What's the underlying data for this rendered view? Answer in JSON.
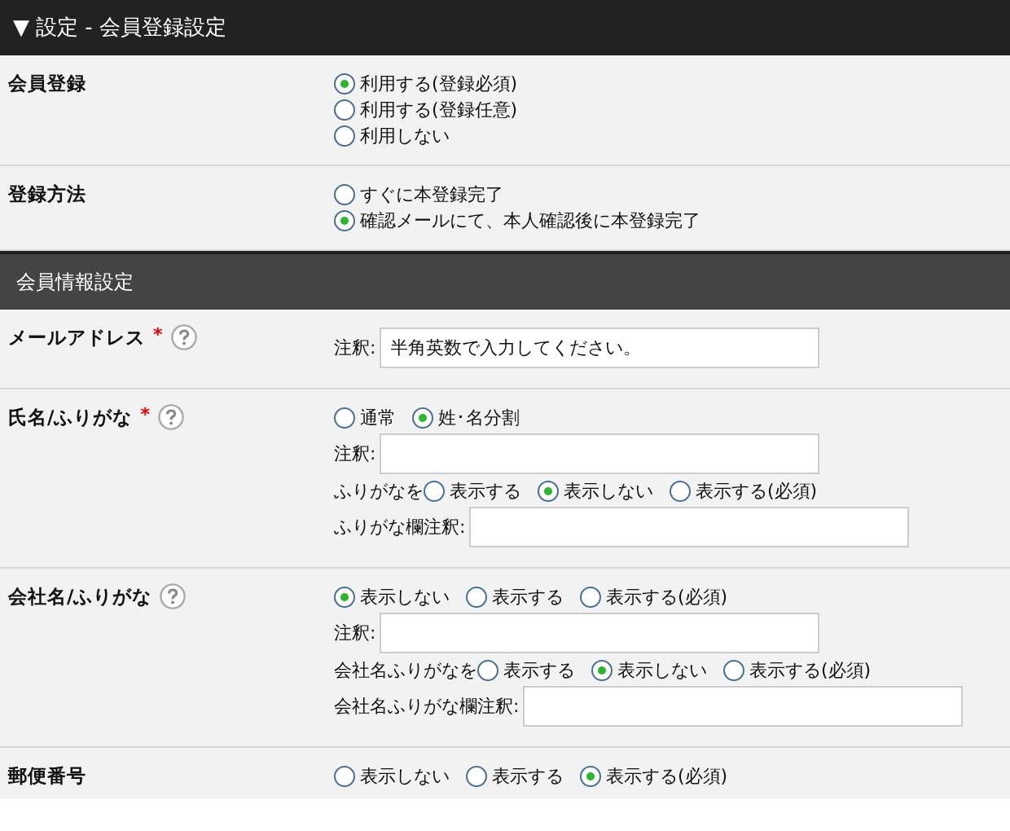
{
  "header": {
    "toggle": "▼",
    "title": "設定 - 会員登録設定"
  },
  "sections": [
    {
      "rows": [
        {
          "label": "会員登録",
          "lines": [
            {
              "kind": "radios",
              "options": [
                {
                  "label": "利用する(登録必須)",
                  "selected": true
                }
              ]
            },
            {
              "kind": "radios",
              "options": [
                {
                  "label": "利用する(登録任意)",
                  "selected": false
                }
              ]
            },
            {
              "kind": "radios",
              "options": [
                {
                  "label": "利用しない",
                  "selected": false
                }
              ]
            }
          ]
        },
        {
          "label": "登録方法",
          "lines": [
            {
              "kind": "radios",
              "options": [
                {
                  "label": "すぐに本登録完了",
                  "selected": false
                }
              ]
            },
            {
              "kind": "radios",
              "options": [
                {
                  "label": "確認メールにて、本人確認後に本登録完了",
                  "selected": true
                }
              ]
            }
          ]
        }
      ]
    },
    {
      "title": "会員情報設定",
      "rows": [
        {
          "label": "メールアドレス",
          "required_mark": "*",
          "help": true,
          "lines": [
            {
              "kind": "field",
              "label": "注釈:",
              "value": "半角英数で入力してください。"
            }
          ]
        },
        {
          "label": "氏名/ふりがな",
          "required_mark": "*",
          "help": true,
          "lines": [
            {
              "kind": "radios",
              "options": [
                {
                  "label": "通常",
                  "selected": false
                },
                {
                  "label": "姓･名分割",
                  "selected": true
                }
              ]
            },
            {
              "kind": "field",
              "label": "注釈:"
            },
            {
              "kind": "radios",
              "prefix": "ふりがなを",
              "options": [
                {
                  "label": "表示する",
                  "selected": false
                },
                {
                  "label": "表示しない",
                  "selected": true
                },
                {
                  "label": "表示する(必須)",
                  "selected": false
                }
              ]
            },
            {
              "kind": "field",
              "label": "ふりがな欄注釈:"
            }
          ]
        },
        {
          "label": "会社名/ふりがな",
          "help": true,
          "lines": [
            {
              "kind": "radios",
              "options": [
                {
                  "label": "表示しない",
                  "selected": true
                },
                {
                  "label": "表示する",
                  "selected": false
                },
                {
                  "label": "表示する(必須)",
                  "selected": false
                }
              ]
            },
            {
              "kind": "field",
              "label": "注釈:"
            },
            {
              "kind": "radios",
              "prefix": "会社名ふりがなを",
              "options": [
                {
                  "label": "表示する",
                  "selected": false
                },
                {
                  "label": "表示しない",
                  "selected": true
                },
                {
                  "label": "表示する(必須)",
                  "selected": false
                }
              ]
            },
            {
              "kind": "field",
              "label": "会社名ふりがな欄注釈:"
            }
          ]
        },
        {
          "label": "郵便番号",
          "lines": [
            {
              "kind": "radios",
              "options": [
                {
                  "label": "表示しない",
                  "selected": false
                },
                {
                  "label": "表示する",
                  "selected": false
                },
                {
                  "label": "表示する(必須)",
                  "selected": true
                }
              ]
            }
          ]
        }
      ]
    }
  ]
}
